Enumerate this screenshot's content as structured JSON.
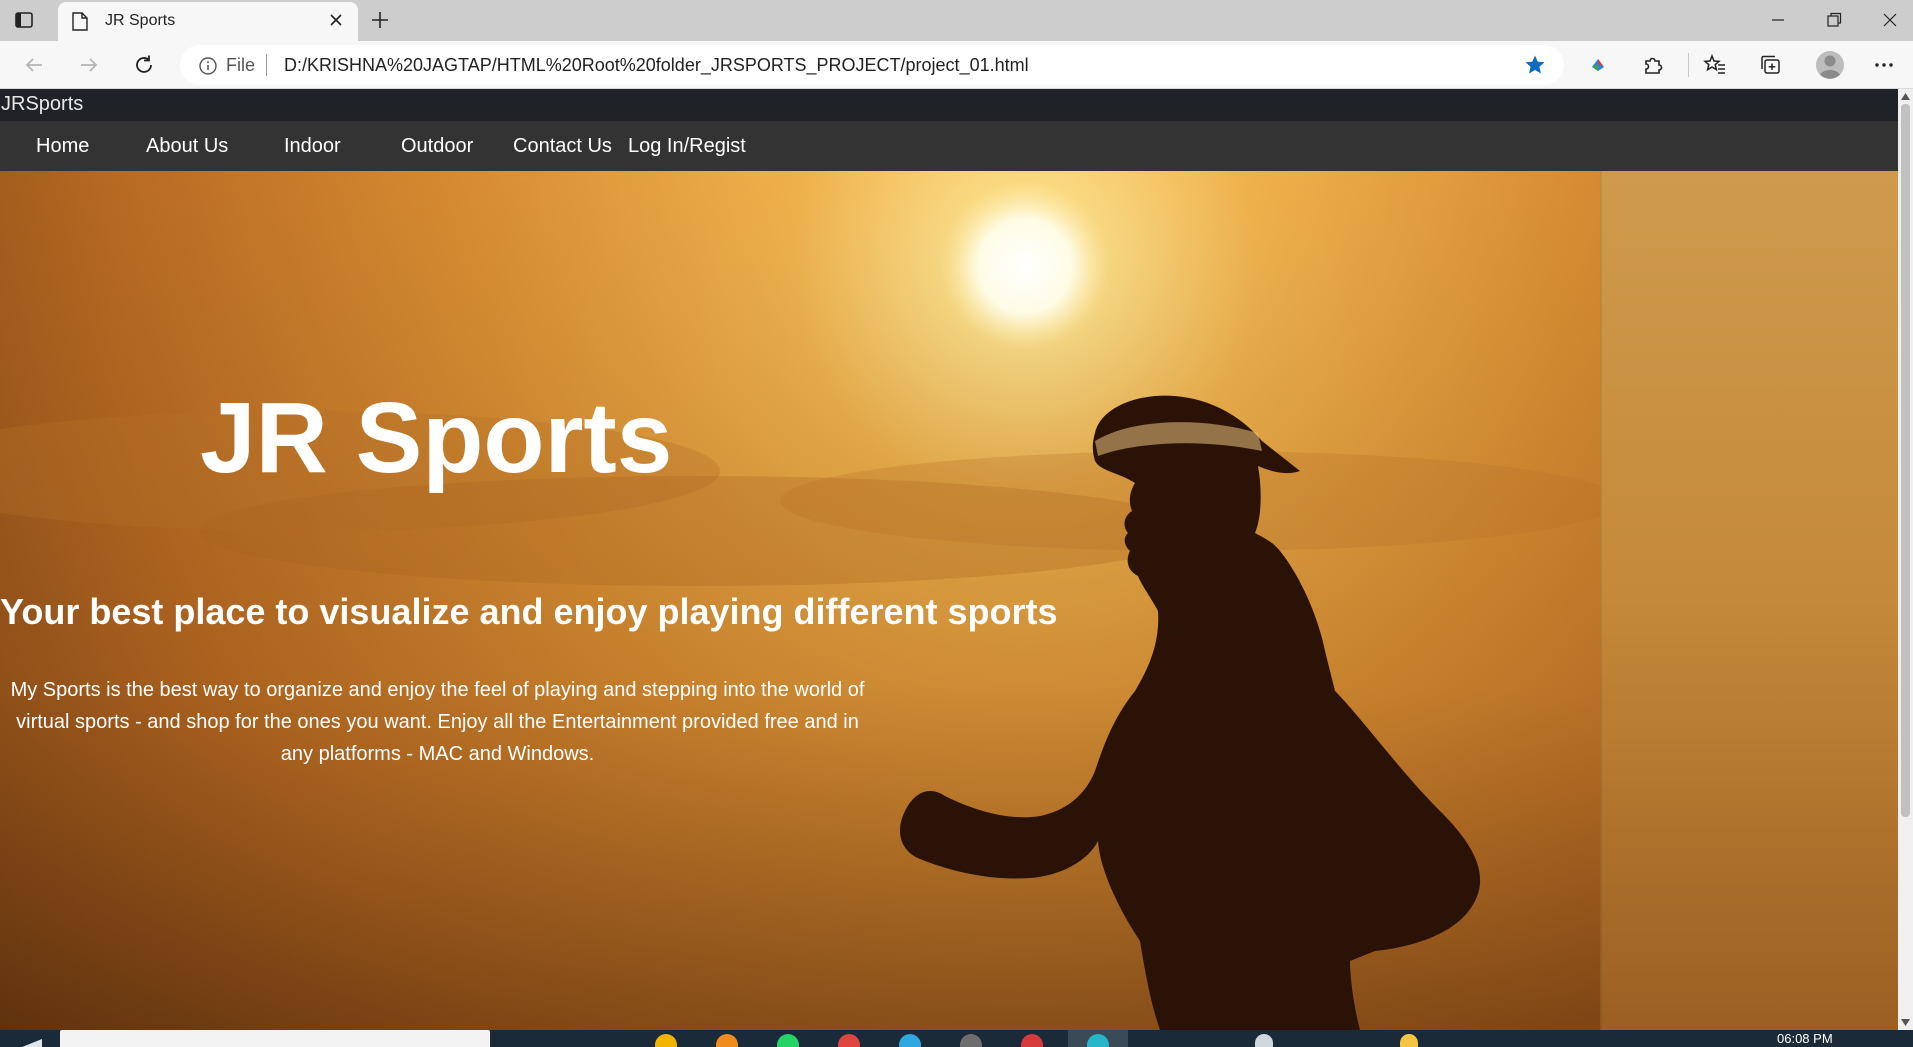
{
  "browser": {
    "tab_title": "JR Sports",
    "address_prefix": "File",
    "url": "D:/KRISHNA%20JAGTAP/HTML%20Root%20folder_JRSPORTS_PROJECT/project_01.html",
    "icons": [
      "tab-actions-icon",
      "page-icon",
      "close-icon",
      "plus-icon",
      "minimize-icon",
      "restore-icon",
      "window-close-icon",
      "back-arrow-icon",
      "forward-arrow-icon",
      "reload-icon",
      "info-icon",
      "star-icon",
      "extension-color-icon",
      "puzzle-icon",
      "favorites-icon",
      "collections-icon",
      "profile-icon",
      "more-icon"
    ],
    "accent_color": "#0f6cbd"
  },
  "site": {
    "brand": "JRSports",
    "nav": {
      "home": "Home",
      "about": "About Us",
      "indoor": "Indoor",
      "outdoor": "Outdoor",
      "contact": "Contact Us",
      "login": "Log In/Regist"
    },
    "hero": {
      "title": "JR Sports",
      "subtitle": "Your best place to visualize and enjoy playing different sports",
      "description": "My Sports is the best way to organize and enjoy the feel of playing and stepping into the world of virtual sports - and shop for the ones you want. Enjoy all the Entertainment provided free and in any platforms - MAC and Windows."
    },
    "colors": {
      "brandbar": "#1f2227",
      "navbar": "#333333",
      "sky": "#e0a044"
    }
  },
  "taskbar": {
    "clock": "06:08 PM"
  }
}
